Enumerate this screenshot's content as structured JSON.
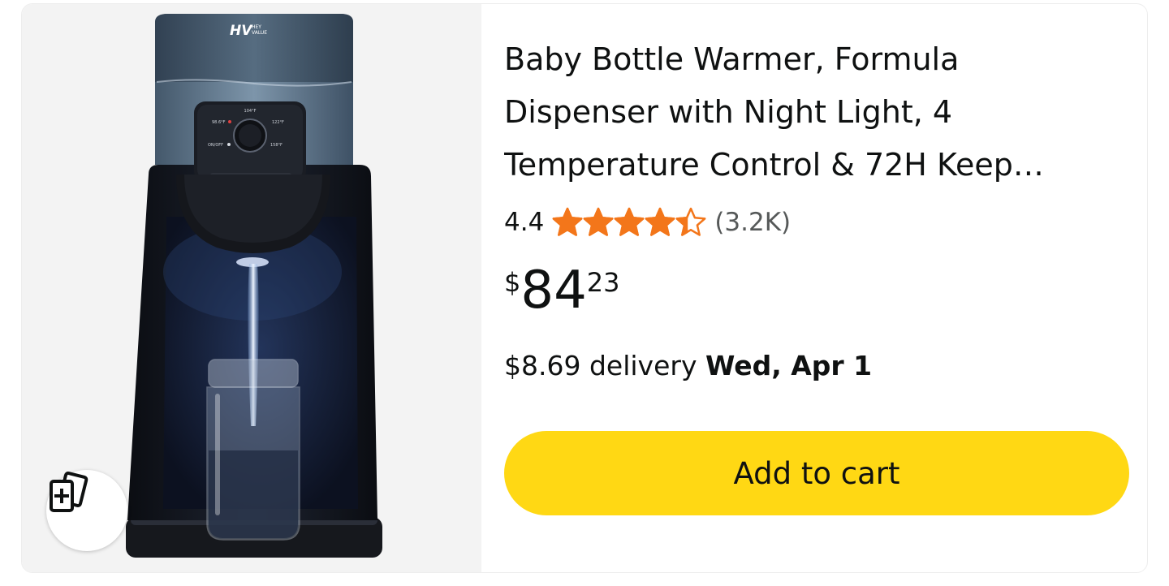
{
  "product": {
    "title": "Baby Bottle Warmer, Formula Dispenser with Night Light, 4 Temperature Control & 72H Keep…",
    "rating": {
      "value": "4.4",
      "stars_out_of_5": 4.4,
      "count": "(3.2K)"
    },
    "price": {
      "symbol": "$",
      "whole": "84",
      "fraction": "23"
    },
    "delivery": {
      "prefix": "$8.69 delivery",
      "date": "Wed, Apr 1"
    },
    "add_to_cart_label": "Add to cart",
    "image": {
      "brand_logo": "HV",
      "brand_name_line1": "HEY",
      "brand_name_line2": "VALUE",
      "temp_labels": [
        "104°F",
        "98.6°F",
        "122°F",
        "ON/OFF",
        "158°F"
      ]
    }
  },
  "icons": {
    "compare": "add-to-compare-icon",
    "star": "star-icon"
  },
  "colors": {
    "star": "#f3761a",
    "cart_button": "#ffd814",
    "image_background": "#f3f3f3"
  }
}
